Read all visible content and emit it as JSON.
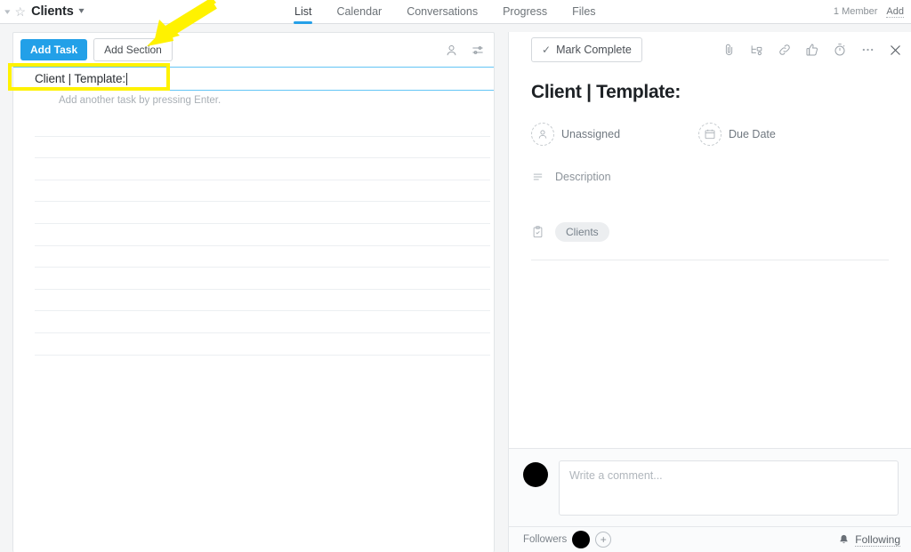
{
  "header": {
    "collapse_icon": "chevron-collapse-icon",
    "star_icon": "star-icon",
    "project_title": "Clients",
    "project_dropdown_icon": "chevron-down-icon",
    "tabs": [
      {
        "label": "List",
        "active": true
      },
      {
        "label": "Calendar",
        "active": false
      },
      {
        "label": "Conversations",
        "active": false
      },
      {
        "label": "Progress",
        "active": false
      },
      {
        "label": "Files",
        "active": false
      }
    ],
    "member_count_label": "1 Member",
    "add_label": "Add",
    "accent_color": "#25a0e8"
  },
  "list_panel": {
    "add_task_label": "Add Task",
    "add_section_label": "Add Section",
    "assignee_icon": "person-icon",
    "filter_icon": "sliders-filter-icon",
    "task_input_value": "Client | Template:",
    "hint_text": "Add another task by pressing Enter.",
    "empty_row_count": 11
  },
  "annotation": {
    "highlight_color": "#fff200",
    "box_target": "task-input-row",
    "arrow_target": "add-section-button"
  },
  "detail_panel": {
    "mark_complete_label": "Mark Complete",
    "check_icon": "check-icon",
    "header_icons": [
      "paperclip-icon",
      "subtask-icon",
      "link-icon",
      "thumbs-up-icon",
      "timer-icon",
      "more-ellipsis-icon",
      "close-icon"
    ],
    "task_title": "Client | Template:",
    "assignee_label": "Unassigned",
    "assignee_icon": "person-icon",
    "due_date_label": "Due Date",
    "due_date_icon": "calendar-icon",
    "description_label": "Description",
    "description_icon": "lines-icon",
    "project_icon": "clipboard-icon",
    "project_tag": "Clients",
    "comment_placeholder": "Write a comment...",
    "commenter_avatar": "redacted-avatar",
    "followers_label": "Followers",
    "follower_avatar": "redacted-avatar",
    "add_follower_label": "+",
    "bell_icon": "bell-icon",
    "following_label": "Following"
  }
}
